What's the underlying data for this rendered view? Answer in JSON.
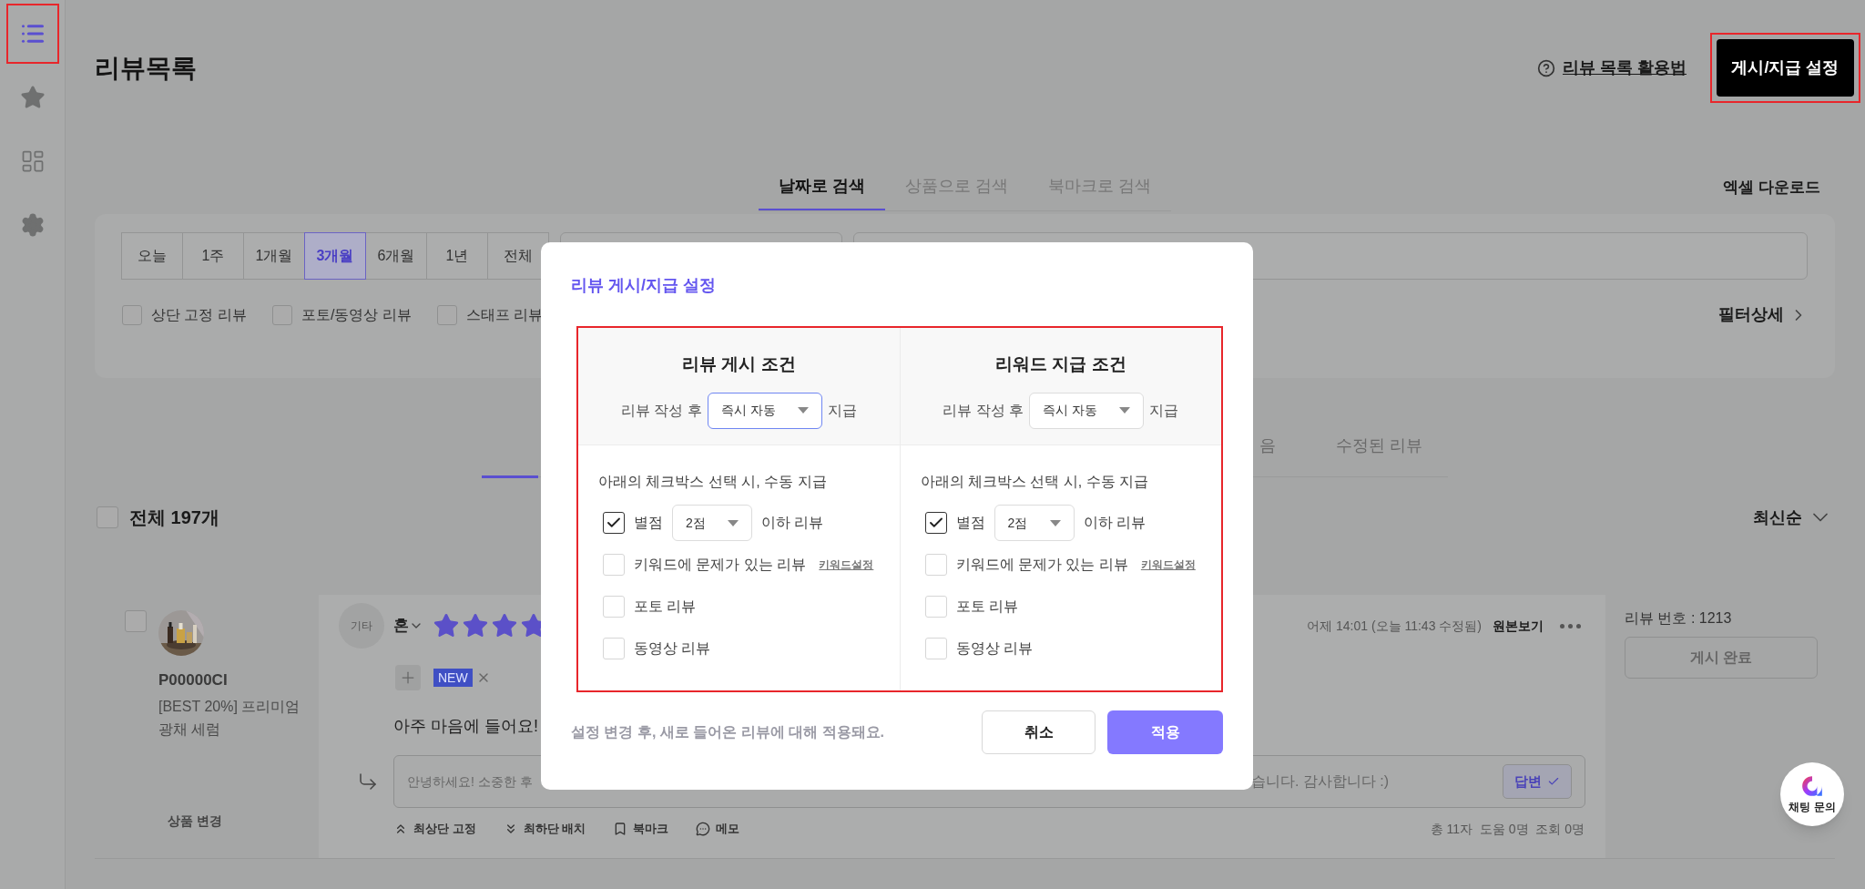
{
  "sidebar": {
    "items": [
      {
        "kind": "list",
        "selected": true,
        "highlighted": true
      },
      {
        "kind": "star",
        "selected": false,
        "highlighted": false
      },
      {
        "kind": "dashboard",
        "selected": false,
        "highlighted": false
      },
      {
        "kind": "settings",
        "selected": false,
        "highlighted": false
      }
    ]
  },
  "header": {
    "title": "리뷰목록",
    "help_link": "리뷰 목록 활용법",
    "settings_button": {
      "label": "게시/지급 설정",
      "highlighted": true
    }
  },
  "search_tabs": [
    {
      "label": "날짜로 검색",
      "selected": true
    },
    {
      "label": "상품으로 검색",
      "selected": false
    },
    {
      "label": "북마크로 검색",
      "selected": false
    }
  ],
  "excel_download": "엑셀 다운로드",
  "filter": {
    "periods": [
      {
        "label": "오늘",
        "selected": false
      },
      {
        "label": "1주",
        "selected": false
      },
      {
        "label": "1개월",
        "selected": false
      },
      {
        "label": "3개월",
        "selected": true
      },
      {
        "label": "6개월",
        "selected": false
      },
      {
        "label": "1년",
        "selected": false
      },
      {
        "label": "전체",
        "selected": false
      }
    ],
    "checks": [
      {
        "label": "상단 고정 리뷰",
        "checked": false
      },
      {
        "label": "포토/동영상 리뷰",
        "checked": false
      },
      {
        "label": "스태프 리뷰",
        "checked": false
      }
    ],
    "detail": "필터상세"
  },
  "list_tabs": [
    {
      "label": "음",
      "selected": false
    },
    {
      "label": "수정된 리뷰",
      "selected": false
    }
  ],
  "select_all": {
    "label": "전체 197개",
    "checked": false
  },
  "sort": "최신순",
  "review": {
    "checked": false,
    "product_code": "P00000CI",
    "product_name": "[BEST 20%] 프리미엄 광채 세럼",
    "change_product": "상품 변경",
    "category": "기타",
    "author": "혼",
    "stars": 4,
    "badge": "NEW",
    "comment": "아주 마음에 들어요!",
    "reply_start": "안녕하세요! 소중한 후",
    "reply_end": "습니다. 감사합니다 :)",
    "reply_button": "답변",
    "actions": [
      {
        "kind": "up",
        "label": "최상단 고정"
      },
      {
        "kind": "down",
        "label": "최하단 배치"
      },
      {
        "kind": "bookmark",
        "label": "북마크"
      },
      {
        "kind": "memo",
        "label": "메모"
      }
    ],
    "time": "어제 14:01 (오늘 11:43 수정됨)",
    "original": "원본보기",
    "stats": "총 11자  도움 0명  조회 0명",
    "number": "리뷰 번호 : 1213",
    "status_button": "게시 완료"
  },
  "chat": "채팅 문의",
  "modal": {
    "title": "리뷰 게시/지급 설정",
    "highlighted": true,
    "columns": [
      {
        "title": "리뷰 게시 조건",
        "before": "리뷰 작성 후",
        "select": {
          "value": "즉시 자동",
          "focused": true
        },
        "after": "지급",
        "intro": "아래의 체크박스 선택 시, 수동 지급",
        "options": [
          {
            "kind": "rating",
            "checked": true,
            "label": "별점",
            "select": "2점",
            "suffix": "이하 리뷰"
          },
          {
            "kind": "keyword",
            "checked": false,
            "label": "키워드에 문제가 있는 리뷰",
            "link": "키워드설정"
          },
          {
            "kind": "plain",
            "checked": false,
            "label": "포토 리뷰"
          },
          {
            "kind": "plain",
            "checked": false,
            "label": "동영상 리뷰"
          }
        ]
      },
      {
        "title": "리워드 지급 조건",
        "before": "리뷰 작성 후",
        "select": {
          "value": "즉시 자동",
          "focused": false
        },
        "after": "지급",
        "intro": "아래의 체크박스 선택 시, 수동 지급",
        "options": [
          {
            "kind": "rating",
            "checked": true,
            "label": "별점",
            "select": "2점",
            "suffix": "이하 리뷰"
          },
          {
            "kind": "keyword",
            "checked": false,
            "label": "키워드에 문제가 있는 리뷰",
            "link": "키워드설정"
          },
          {
            "kind": "plain",
            "checked": false,
            "label": "포토 리뷰"
          },
          {
            "kind": "plain",
            "checked": false,
            "label": "동영상 리뷰"
          }
        ]
      }
    ],
    "note": "설정 변경 후, 새로 들어온 리뷰에 대해 적용돼요.",
    "cancel": "취소",
    "apply": "적용"
  }
}
